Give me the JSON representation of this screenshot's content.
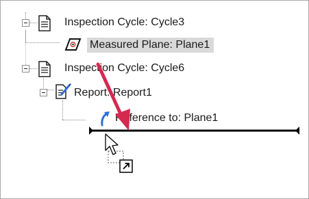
{
  "tree": {
    "nodes": [
      {
        "label": "Inspection Cycle: Cycle3",
        "icon": "document-icon",
        "expanded": true
      },
      {
        "label": "Measured Plane: Plane1",
        "icon": "measured-plane-icon",
        "selected": true
      },
      {
        "label": "Inspection Cycle: Cycle6",
        "icon": "document-icon",
        "expanded": true
      },
      {
        "label": "Report: Report1",
        "icon": "report-icon",
        "expanded": true
      },
      {
        "label": "Reference to: Plane1",
        "icon": "reference-arrow-icon"
      }
    ]
  },
  "colors": {
    "annotation_arrow": "#d6294f",
    "selection_background": "#d9d9d9",
    "drop_indicator": "#000000"
  }
}
